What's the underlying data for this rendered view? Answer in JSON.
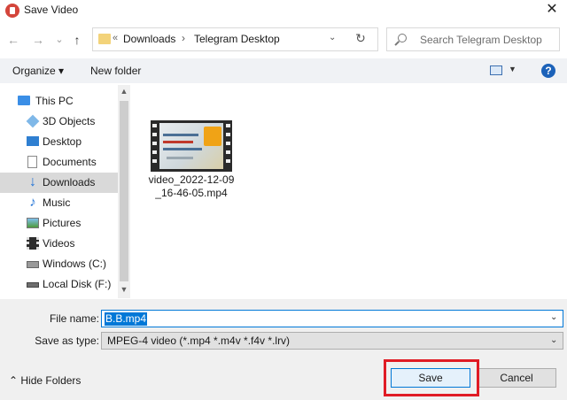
{
  "window": {
    "title": "Save Video",
    "close_glyph": "✕"
  },
  "nav": {
    "back_glyph": "←",
    "forward_glyph": "→",
    "recent_glyph": "⌄",
    "up_glyph": "↑"
  },
  "address": {
    "prefix": "«",
    "crumbs": [
      "Downloads",
      "Telegram Desktop"
    ],
    "chevron": "›",
    "dropdown_glyph": "⌄",
    "refresh_glyph": "↻"
  },
  "search": {
    "placeholder": "Search Telegram Desktop"
  },
  "toolbar": {
    "organize": "Organize ▾",
    "new_folder": "New folder",
    "view_drop": "▼",
    "help": "?"
  },
  "nav_pane": {
    "items": [
      {
        "label": "This PC",
        "icon": "pc-icon"
      },
      {
        "label": "3D Objects",
        "icon": "3d-objects-icon"
      },
      {
        "label": "Desktop",
        "icon": "desktop-icon"
      },
      {
        "label": "Documents",
        "icon": "documents-icon"
      },
      {
        "label": "Downloads",
        "icon": "downloads-icon",
        "selected": true
      },
      {
        "label": "Music",
        "icon": "music-icon"
      },
      {
        "label": "Pictures",
        "icon": "pictures-icon"
      },
      {
        "label": "Videos",
        "icon": "videos-icon"
      },
      {
        "label": "Windows (C:)",
        "icon": "drive-c-icon"
      },
      {
        "label": "Local Disk (F:)",
        "icon": "drive-f-icon"
      }
    ],
    "scroll_up": "▲",
    "scroll_down": "▼"
  },
  "files": [
    {
      "name_line1": "video_2022-12-09",
      "name_line2": "_16-46-05.mp4"
    }
  ],
  "form": {
    "file_name_label": "File name:",
    "file_name_value": "B.B.mp4",
    "save_as_type_label": "Save as type:",
    "save_as_type_value": "MPEG-4 video (*.mp4 *.m4v *.f4v *.lrv)",
    "drop_glyph": "⌄"
  },
  "footer": {
    "hide_folders": "⌃  Hide Folders",
    "save": "Save",
    "cancel": "Cancel"
  },
  "colors": {
    "accent": "#0078d7",
    "highlight": "#e01b24"
  }
}
